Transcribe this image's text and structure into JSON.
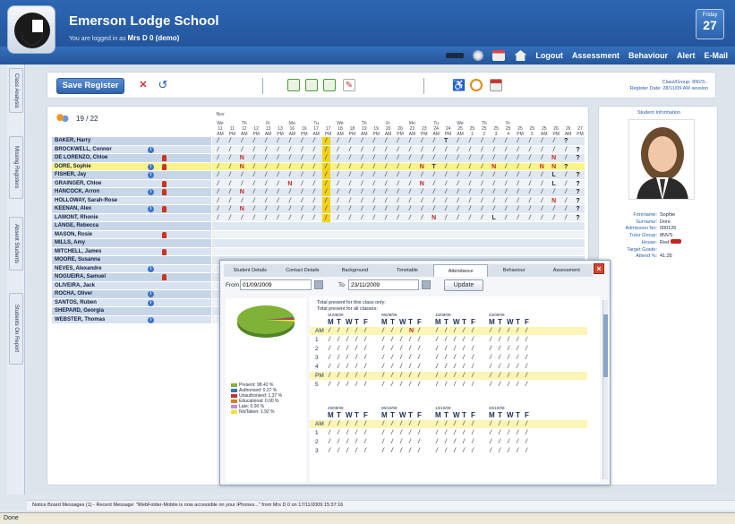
{
  "header": {
    "school": "Emerson Lodge School",
    "logged_in_prefix": "You are logged in as",
    "user": "Mrs D 0 (demo)",
    "day": "Friday",
    "date": "27"
  },
  "nav": [
    "Logout",
    "Assessment",
    "Behaviour",
    "Alert",
    "E-Mail"
  ],
  "sidetabs": [
    "Class Analysis",
    "Missing Registers",
    "Absent Students",
    "Students On Report"
  ],
  "toolbar": {
    "save_label": "Save Register",
    "class_group": "Class/Group: 8NVS -",
    "register_date": "Register Date: 28/11/09 AM session"
  },
  "register": {
    "count": "19 / 22",
    "months": [
      {
        "label": "Nov",
        "col": 0
      }
    ],
    "day_names": [
      "We",
      "Th",
      "Fr",
      "Mo",
      "Tu",
      "We",
      "Th",
      "Fr",
      "Mo",
      "Tu",
      "We",
      "Th",
      "Fr"
    ],
    "day_nums": [
      "11",
      "11",
      "12",
      "12",
      "13",
      "13",
      "16",
      "16",
      "17",
      "17",
      "18",
      "18",
      "19",
      "19",
      "20",
      "20",
      "23",
      "23",
      "24",
      "24",
      "25",
      "25",
      "25",
      "25",
      "25",
      "25",
      "25",
      "25",
      "26",
      "26",
      "27"
    ],
    "sessions": [
      "AM",
      "PM",
      "AM",
      "PM",
      "AM",
      "PM",
      "AM",
      "PM",
      "AM",
      "PM",
      "AM",
      "PM",
      "AM",
      "PM",
      "AM",
      "PM",
      "AM",
      "PM",
      "AM",
      "PM",
      "AM",
      "1",
      "2",
      "3",
      "4",
      "PM",
      "5",
      "AM",
      "PM",
      "AM",
      "PM",
      "AM"
    ],
    "students": [
      {
        "name": "BAKER, Harry",
        "info": false,
        "flag": false,
        "cells": "////////// /////////T/////// //?"
      },
      {
        "name": "BROCKWELL, Connor",
        "info": true,
        "flag": false,
        "cells": "//////////////////////////// //?"
      },
      {
        "name": "DE LORENZO, Chloe",
        "info": false,
        "flag": true,
        "cells": "//N///////////////////////// N/?"
      },
      {
        "name": "DORE, Sophie",
        "info": true,
        "flag": true,
        "cells": "//N/////// ///////NT////N/// NN?"
      },
      {
        "name": "FISHER, Jay",
        "info": true,
        "flag": false,
        "cells": "//////////////////////////// L/?"
      },
      {
        "name": "GRAINGER, Chloe",
        "info": false,
        "flag": true,
        "cells": "//////N//////////N////////// L/?"
      },
      {
        "name": "HANCOCK, Arron",
        "info": true,
        "flag": true,
        "cells": "//N///////////////////////// //?"
      },
      {
        "name": "HOLLOWAY, Sarah-Rose",
        "info": false,
        "flag": false,
        "cells": "//////////////////////////// N/?"
      },
      {
        "name": "KEENAN, Alex",
        "info": true,
        "flag": true,
        "cells": "//N///////////////////////// //?"
      },
      {
        "name": "LAMONT, Rhonie",
        "info": false,
        "flag": false,
        "cells": "//////////////////N////L//// //?"
      },
      {
        "name": "LANGE, Rebecca",
        "info": false,
        "flag": false,
        "cells": ""
      },
      {
        "name": "MASON, Rosie",
        "info": false,
        "flag": true,
        "cells": ""
      },
      {
        "name": "MILLS, Amy",
        "info": false,
        "flag": false,
        "cells": ""
      },
      {
        "name": "MITCHELL, James",
        "info": false,
        "flag": true,
        "cells": ""
      },
      {
        "name": "MOORE, Susanna",
        "info": false,
        "flag": false,
        "cells": ""
      },
      {
        "name": "NEVES, Alexandre",
        "info": true,
        "flag": false,
        "cells": ""
      },
      {
        "name": "NOGUEIRA, Samuel",
        "info": false,
        "flag": true,
        "cells": ""
      },
      {
        "name": "OLIVEIRA, Jack",
        "info": false,
        "flag": false,
        "cells": ""
      },
      {
        "name": "ROCHA, Oliver",
        "info": true,
        "flag": false,
        "cells": ""
      },
      {
        "name": "SANTOS, Ruben",
        "info": true,
        "flag": false,
        "cells": ""
      },
      {
        "name": "SHEPARD, Georgia",
        "info": false,
        "flag": false,
        "cells": ""
      },
      {
        "name": "WEBSTER, Thomas",
        "info": true,
        "flag": false,
        "cells": ""
      }
    ]
  },
  "student_info": {
    "title": "Student Information",
    "fields": [
      [
        "Forename:",
        "Sophie"
      ],
      [
        "Surname:",
        "Dore"
      ],
      [
        "Admission No:",
        "000126"
      ],
      [
        "Tutor Group:",
        "8NVS"
      ],
      [
        "House:",
        "Red"
      ],
      [
        "Target Grade:",
        ""
      ],
      [
        "Attend %:",
        "41.35"
      ]
    ]
  },
  "popup": {
    "tabs": [
      "Student Details",
      "Contact Details",
      "Background",
      "Timetable",
      "Attendance",
      "Behaviour",
      "Assessment"
    ],
    "active_tab": "Attendance",
    "from_label": "From",
    "from_value": "01/09/2009",
    "to_label": "To",
    "to_value": "23/11/2009",
    "update_label": "Update",
    "note1": "Total present for this class only:",
    "note2": "Total present for all classes:",
    "weeks_top": [
      "31/08/09",
      "06/09/09",
      "15/09/09",
      "22/09/09"
    ],
    "weeks_bottom": [
      "29/09/09",
      "06/10/09",
      "13/10/09",
      "20/10/09"
    ],
    "days": [
      "M",
      "T",
      "W",
      "T",
      "F"
    ],
    "rows_top": [
      "AM",
      "1",
      "2",
      "3",
      "4",
      "PM",
      "5"
    ],
    "rows_bottom": [
      "AM",
      "1",
      "2",
      "3"
    ],
    "legend": [
      {
        "label": "Present: 98.42 %",
        "color": "#7fb236"
      },
      {
        "label": "Authorised: 0.27 %",
        "color": "#3d6fc0"
      },
      {
        "label": "Unauthorised: 1.37 %",
        "color": "#c83226"
      },
      {
        "label": "Educational: 0.00 %",
        "color": "#e27b1e"
      },
      {
        "label": "Late: 0.00 %",
        "color": "#c78ad6"
      },
      {
        "label": "NotTaken: 1.92 %",
        "color": "#f3e03a"
      }
    ]
  },
  "notice": "Notice Board Messages (1) - Recent Message: \"WebFolder-Mobile is now accessible on your iPhones...\" from Mrs D 0 on 17/11/2009 15:37:16",
  "browser_status": "Done"
}
